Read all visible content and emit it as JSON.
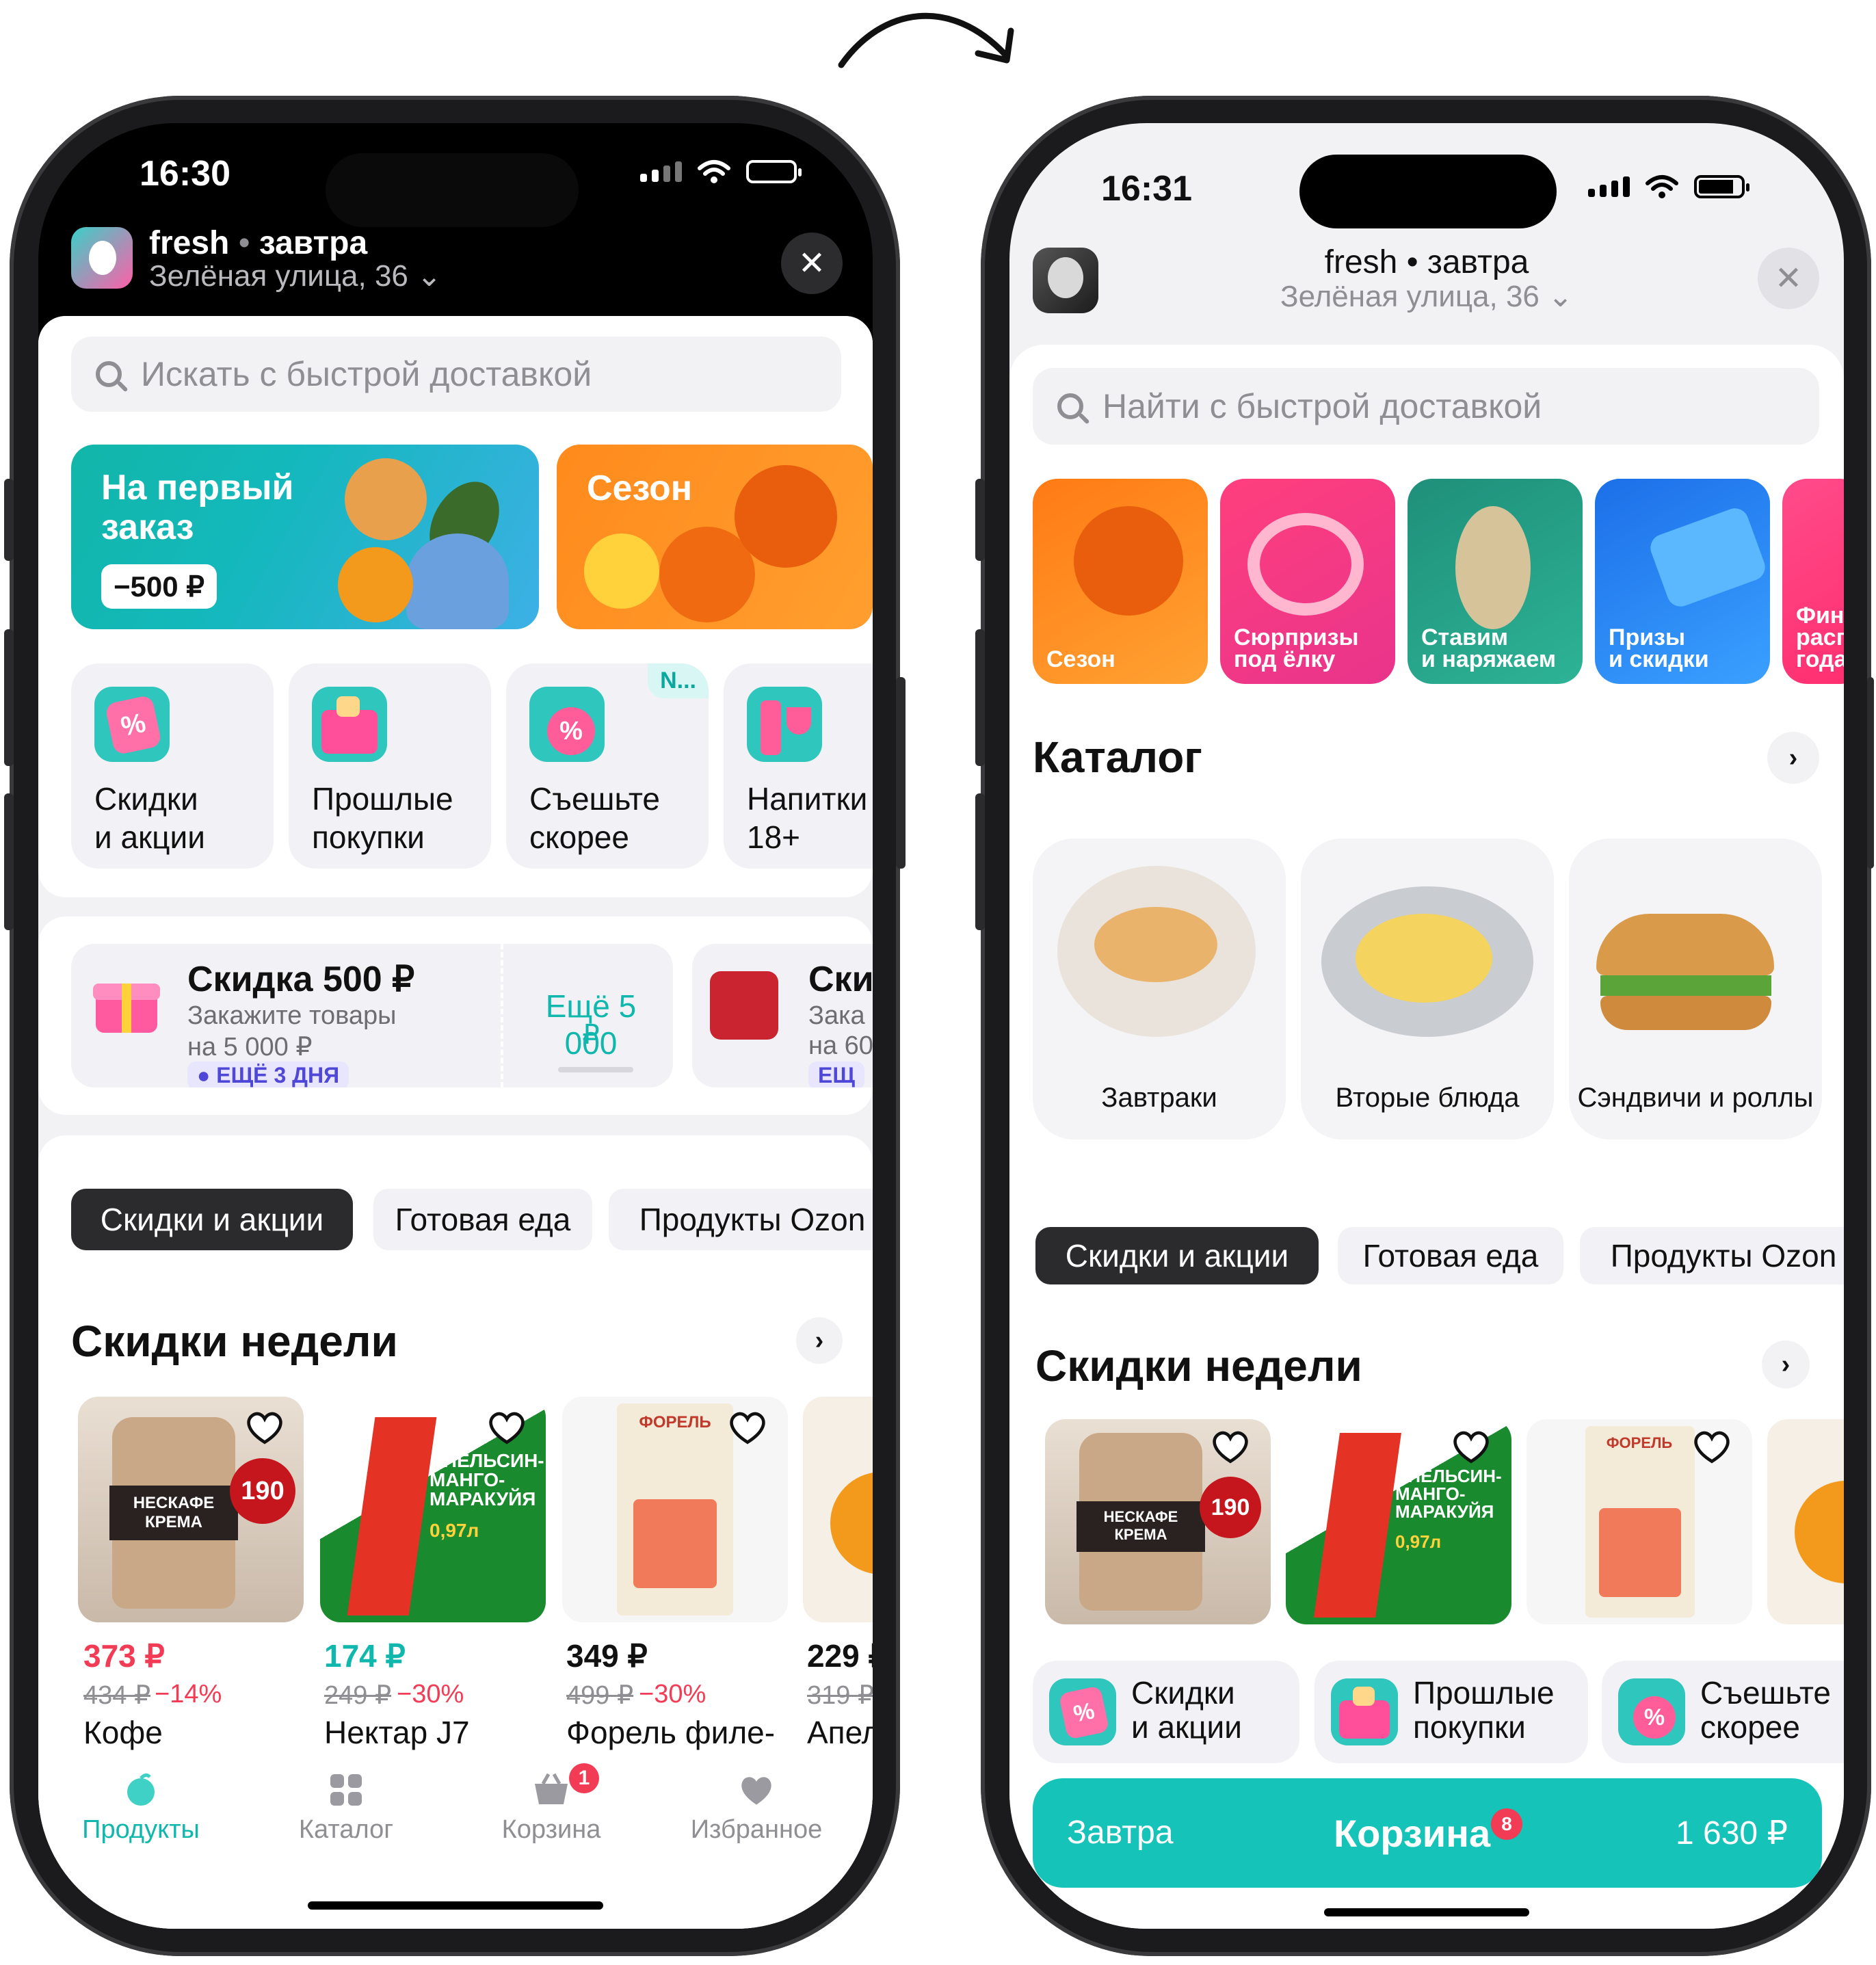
{
  "left": {
    "status": {
      "time": "16:30"
    },
    "header": {
      "brand": "fresh",
      "sep": "•",
      "delivery": "завтра",
      "address": "Зелёная улица, 36 ⌄"
    },
    "search": {
      "placeholder": "Искать с быстрой доставкой"
    },
    "banners": [
      {
        "title": "На первый\nзаказ",
        "badge": "−500 ₽"
      },
      {
        "title": "Сезон"
      }
    ],
    "quick": [
      {
        "label": "Скидки\nи акции"
      },
      {
        "label": "Прошлые\nпокупки"
      },
      {
        "label": "Съешьте\nскорее",
        "badge": "N..."
      },
      {
        "label": "Напитки\n18+"
      }
    ],
    "promo": {
      "title": "Скидка 500 ₽",
      "desc1": "Закажите товары",
      "desc2": "на 5 000 ₽",
      "tag": "ЕЩЁ 3 ДНЯ",
      "more1": "Ещё 5 000",
      "more2": "₽",
      "title2": "Ски",
      "desc1b": "Зака",
      "desc2b": "на 60",
      "tag2": "ЕЩ"
    },
    "chips": [
      "Скидки и акции",
      "Готовая еда",
      "Продукты Ozon"
    ],
    "section": "Скидки недели",
    "products": [
      {
        "price": "373 ₽",
        "old": "434 ₽",
        "disc": "−14%",
        "name": "Кофе"
      },
      {
        "price": "174 ₽",
        "old": "249 ₽",
        "disc": "−30%",
        "name": "Нектар J7"
      },
      {
        "price": "349 ₽",
        "old": "499 ₽",
        "disc": "−30%",
        "name": "Форель филе-"
      },
      {
        "price": "229 ₽",
        "old": "319 ₽",
        "disc": "",
        "name": "Апел"
      }
    ],
    "tabbar": [
      {
        "label": "Продукты"
      },
      {
        "label": "Каталог"
      },
      {
        "label": "Корзина",
        "badge": "1"
      },
      {
        "label": "Избранное"
      }
    ]
  },
  "right": {
    "status": {
      "time": "16:31"
    },
    "header": {
      "brand": "fresh",
      "sep": "•",
      "delivery": "завтра",
      "address": "Зелёная улица, 36 ⌄"
    },
    "search": {
      "placeholder": "Найти с быстрой доставкой"
    },
    "stories": [
      {
        "label": "Сезон"
      },
      {
        "label": "Сюрпризы\nпод ёлку"
      },
      {
        "label": "Ставим\nи наряжаем"
      },
      {
        "label": "Призы\nи скидки"
      },
      {
        "label": "Фин\nрасп\nгода"
      }
    ],
    "catalog_title": "Каталог",
    "catalog": [
      {
        "label": "Завтраки"
      },
      {
        "label": "Вторые блюда"
      },
      {
        "label": "Сэндвичи и роллы"
      }
    ],
    "chips": [
      "Скидки и акции",
      "Готовая еда",
      "Продукты Ozon"
    ],
    "section": "Скидки недели",
    "quick": [
      {
        "label": "Скидки\nи акции"
      },
      {
        "label": "Прошлые\nпокупки"
      },
      {
        "label": "Съешьте\nскорее"
      }
    ],
    "cart": {
      "day": "Завтра",
      "title": "Корзина",
      "count": "8",
      "total": "1 630 ₽"
    }
  },
  "image_labels": {
    "nescafe": "НЕСКАФЕ",
    "krema": "КРЕМА",
    "grams": "190",
    "j7_text": "АПЕЛЬСИН-\nМАНГО-\nМАРАКУЙЯ",
    "j7_vol": "0,97л",
    "trout": "ФОРЕЛЬ"
  },
  "colors": {
    "accent": "#00c2b8",
    "sale": "#f23b55",
    "dark": "#2b2b2e"
  }
}
